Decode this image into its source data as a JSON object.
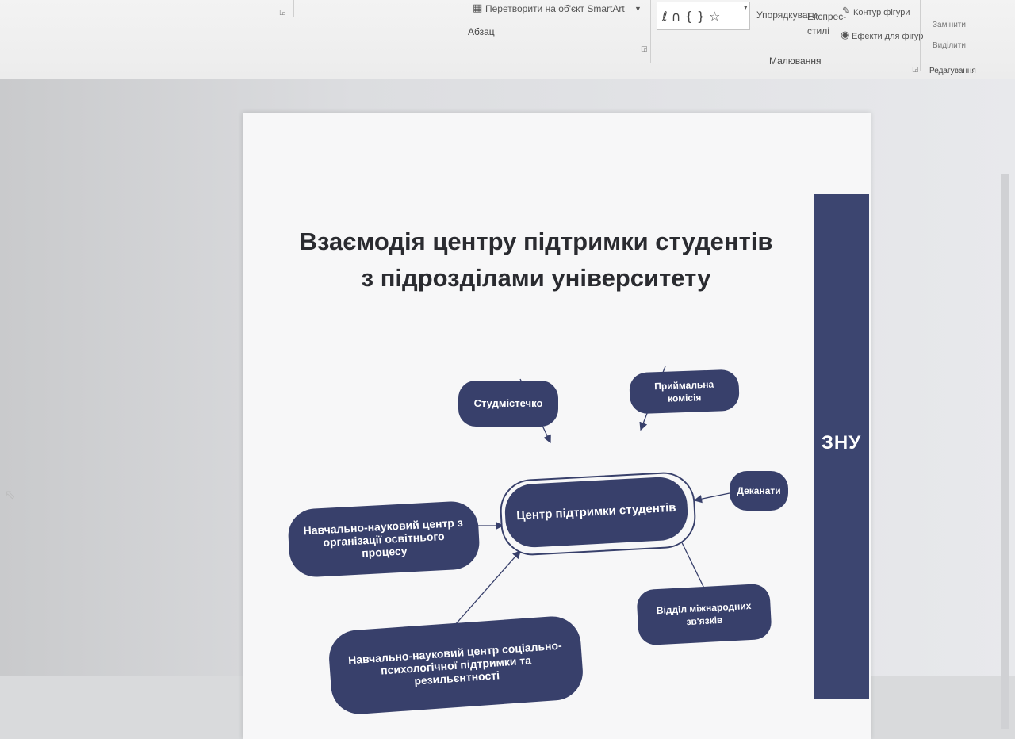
{
  "ribbon": {
    "convert_smartart": "Перетворити на об'єкт SmartArt",
    "paragraph_label": "Абзац",
    "drawing_label": "Малювання",
    "arrange_label": "Упорядкувати",
    "quick_styles_label": "Експрес-стилі",
    "shape_outline": "Контур фігури",
    "shape_effects": "Ефекти для фігур",
    "editing_label": "Редагування",
    "replace_label": "Замінити",
    "select_label": "Виділити"
  },
  "slide": {
    "title_line1": "Взаємодія центру підтримки студентів",
    "title_line2": "з підрозділами університету",
    "logo": "ЗНУ",
    "center_node": "Центр підтримки студентів",
    "nodes": {
      "studmistechko": "Студмістечко",
      "admissions": "Приймальна комісія",
      "deanery": "Деканати",
      "education_center": "Навчально-науковий центр з організації освітнього процесу",
      "international": "Відділ міжнародних зв'язків",
      "psych_center": "Навчально-науковий центр соціально-психологічної підтримки та резильєнтності"
    }
  },
  "colors": {
    "node_fill": "#38406b",
    "brand_bar": "#3c4570",
    "slide_bg": "#f7f7f8"
  }
}
